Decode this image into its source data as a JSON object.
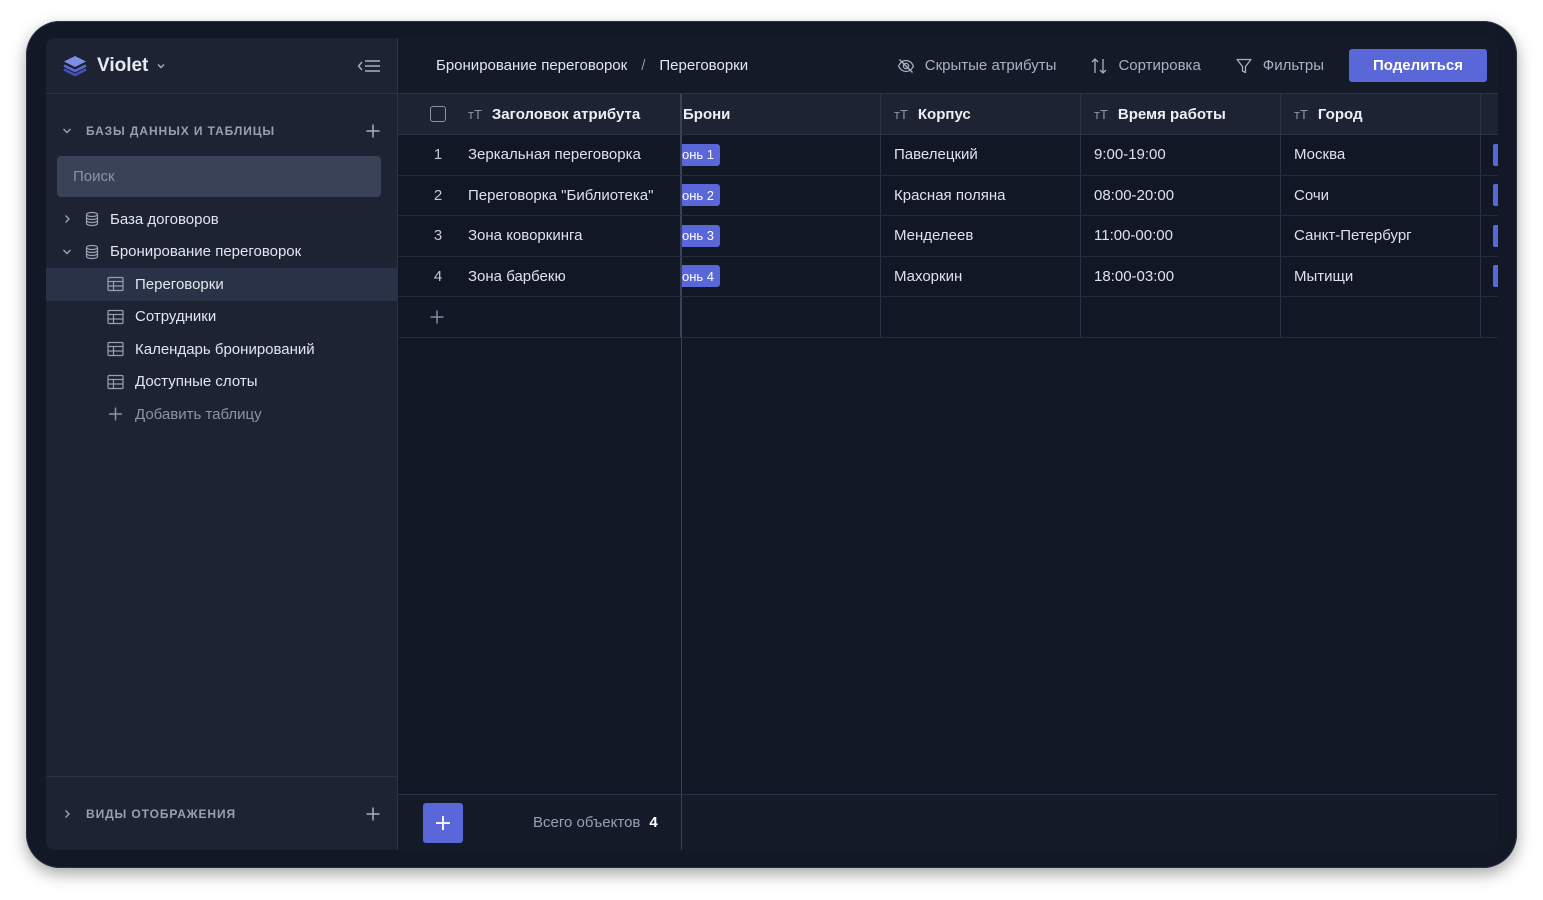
{
  "app": {
    "name": "Violet"
  },
  "sidebar": {
    "databases_header": "БАЗЫ ДАННЫХ И ТАБЛИЦЫ",
    "search_placeholder": "Поиск",
    "databases": [
      {
        "label": "База договоров",
        "expanded": false
      },
      {
        "label": "Бронирование переговорок",
        "expanded": true
      }
    ],
    "tables": [
      {
        "label": "Переговорки",
        "active": true
      },
      {
        "label": "Сотрудники",
        "active": false
      },
      {
        "label": "Календарь бронирований",
        "active": false
      },
      {
        "label": "Доступные слоты",
        "active": false
      }
    ],
    "add_table_label": "Добавить таблицу",
    "views_header": "ВИДЫ ОТОБРАЖЕНИЯ"
  },
  "header": {
    "breadcrumb": [
      "Бронирование переговорок",
      "Переговорки"
    ],
    "breadcrumb_separator": "/",
    "tools": {
      "hidden_attributes": "Скрытые атрибуты",
      "sort": "Сортировка",
      "filters": "Фильтры"
    },
    "share_label": "Поделиться"
  },
  "table": {
    "columns": {
      "title": "Заголовок атрибута",
      "bookings": "Брони",
      "building": "Корпус",
      "hours": "Время работы",
      "city": "Город"
    },
    "type_icon": "тТ",
    "rows": [
      {
        "num": "1",
        "title": "Зеркальная переговорка",
        "booking": "онь 1",
        "building": "Павелецкий",
        "hours": "9:00-19:00",
        "city": "Москва"
      },
      {
        "num": "2",
        "title": "Переговорка \"Библиотека\"",
        "booking": "онь 2",
        "building": "Красная поляна",
        "hours": "08:00-20:00",
        "city": "Сочи"
      },
      {
        "num": "3",
        "title": "Зона коворкинга",
        "booking": "онь 3",
        "building": "Менделеев",
        "hours": "11:00-00:00",
        "city": "Санкт-Петербург"
      },
      {
        "num": "4",
        "title": "Зона барбекю",
        "booking": "онь 4",
        "building": "Махоркин",
        "hours": "18:00-03:00",
        "city": "Мытищи"
      }
    ]
  },
  "footer": {
    "total_label": "Всего объектов",
    "total_count": "4"
  },
  "colors": {
    "accent": "#5a67d8",
    "sidebar_bg": "#1d2333",
    "main_bg": "#121725"
  }
}
